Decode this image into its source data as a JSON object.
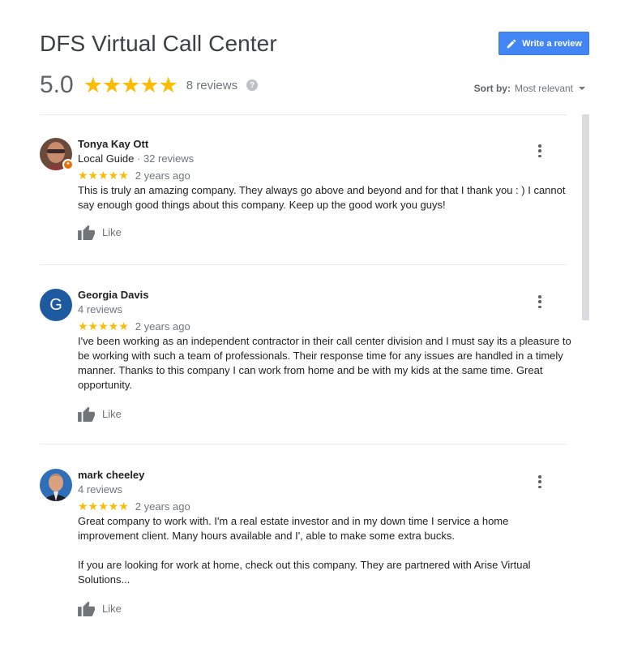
{
  "header": {
    "title": "DFS Virtual Call Center",
    "write_review_label": "Write a review",
    "rating": "5.0",
    "stars": "★★★★★",
    "review_count": "8 reviews",
    "help_glyph": "?",
    "sort_label": "Sort by:",
    "sort_value": "Most relevant"
  },
  "colors": {
    "accent": "#4285f4",
    "star": "#fbbc04",
    "guide_badge": "#e8710a",
    "avatar_letter_bg": "#1e5aa0"
  },
  "reviews": [
    {
      "name": "Tonya Kay Ott",
      "meta_guide": "Local Guide",
      "meta_sep": " · ",
      "meta_count": "32 reviews",
      "stars": "★★★★★",
      "time": "2 years ago",
      "text": "This is truly an amazing company. They always go above and beyond and for that I thank you : ) I cannot say enough good things about this company. Keep up the good work you guys!",
      "like_label": "Like"
    },
    {
      "name": "Georgia Davis",
      "avatar_letter": "G",
      "meta_count": "4 reviews",
      "stars": "★★★★★",
      "time": "2 years ago",
      "text": "I've been working as an independent contractor in their call center division and I must say its a pleasure to be working with such a team of professionals.   Their response time for any issues are handled in a timely manner.  Thanks to this company I can work from home and be with my kids at the same time. Great opportunity.",
      "like_label": "Like"
    },
    {
      "name": "mark cheeley",
      "meta_count": "4 reviews",
      "stars": "★★★★★",
      "time": "2 years ago",
      "text": "Great company to work with.  I'm a real estate investor and in my down time I service a home improvement client.  Many hours available and I', able to make some extra bucks.\n\nIf you are looking for work at home, check out this company.  They are partnered with Arise Virtual Solutions...",
      "like_label": "Like"
    }
  ]
}
